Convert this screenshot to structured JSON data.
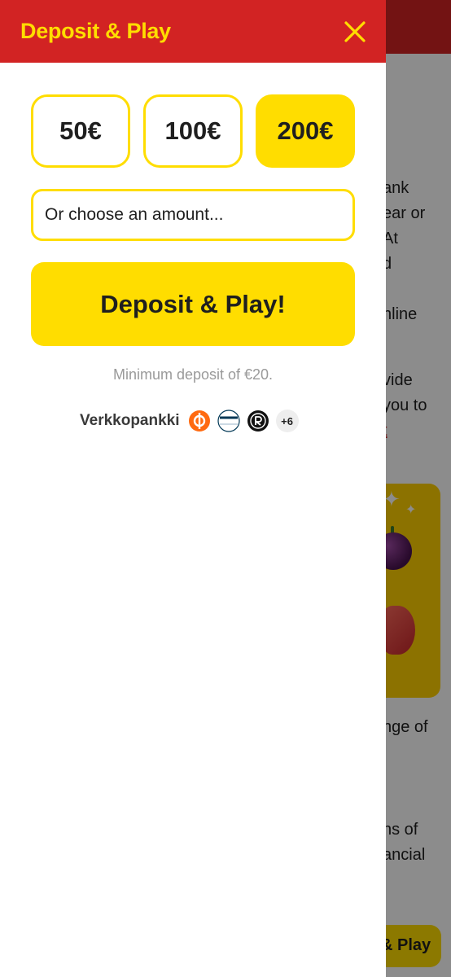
{
  "drawer": {
    "title": "Deposit & Play",
    "amounts": [
      {
        "label": "50€",
        "selected": false
      },
      {
        "label": "100€",
        "selected": false
      },
      {
        "label": "200€",
        "selected": true
      }
    ],
    "amount_placeholder": "Or choose an amount...",
    "deposit_button": "Deposit & Play!",
    "min_note": "Minimum deposit of €20.",
    "payment_label": "Verkkopankki",
    "payment_icons": [
      "op-bank-icon",
      "danske-bank-icon",
      "revolut-icon"
    ],
    "more_count": "+6"
  },
  "background": {
    "lines": [
      "ank",
      "ear or",
      "At",
      "d",
      "nline",
      "vide",
      "you to",
      "t",
      "nge of",
      "ns of",
      "ancial"
    ],
    "button": "& Play"
  },
  "colors": {
    "brand_red": "#d22323",
    "brand_yellow": "#ffdd00"
  }
}
